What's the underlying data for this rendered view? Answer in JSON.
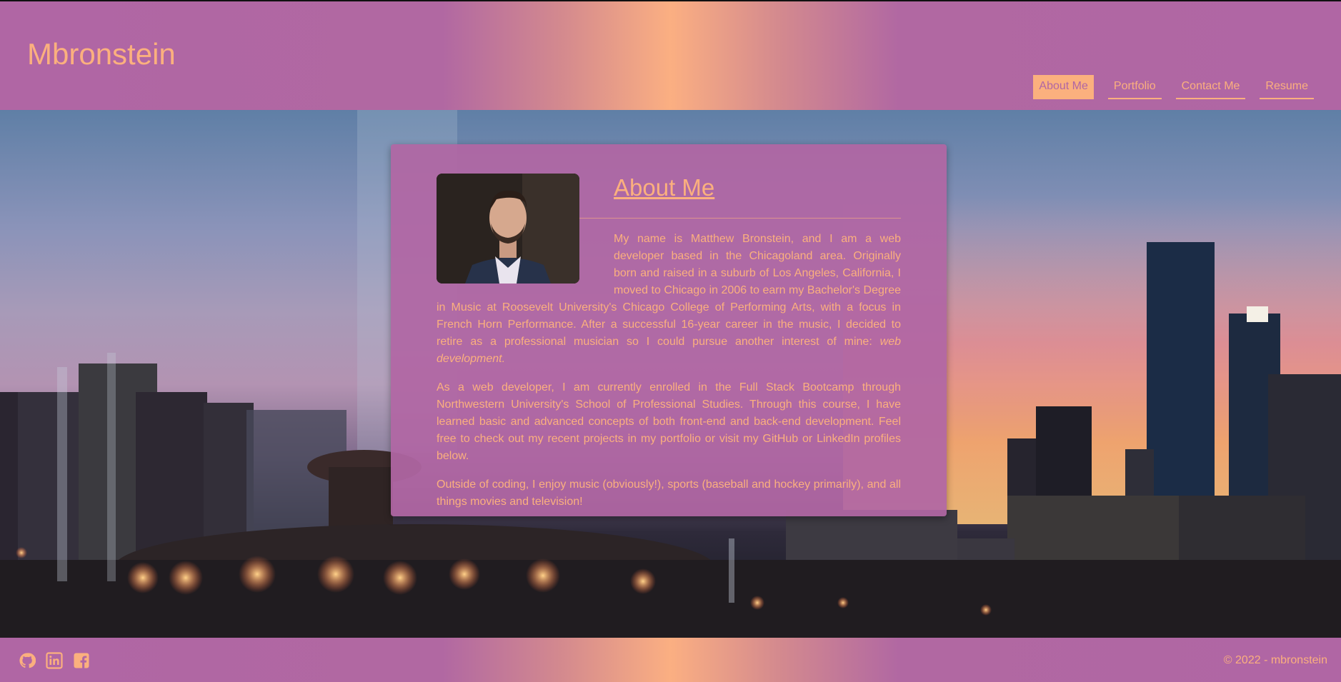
{
  "header": {
    "site_title": "Mbronstein",
    "nav": [
      {
        "label": "About Me",
        "active": true
      },
      {
        "label": "Portfolio",
        "active": false
      },
      {
        "label": "Contact Me",
        "active": false
      },
      {
        "label": "Resume",
        "active": false
      }
    ]
  },
  "about": {
    "title": "About Me",
    "paragraph1_main": "My name is Matthew Bronstein, and I am a web developer based in the Chicagoland area. Originally born and raised in a suburb of Los Angeles, California, I moved to Chicago in 2006 to earn my Bachelor's Degree in Music at Roosevelt University's Chicago College of Performing Arts, with a focus in French Horn Performance. After a successful 16-year career in the music, I decided to retire as a professional musician so I could pursue another interest of mine: ",
    "paragraph1_emphasis": "web development.",
    "paragraph2": "As a web developer, I am currently enrolled in the Full Stack Bootcamp through Northwestern University's School of Professional Studies. Through this course, I have learned basic and advanced concepts of both front-end and back-end development. Feel free to check out my recent projects in my portfolio or visit my GitHub or LinkedIn profiles below.",
    "paragraph3": "Outside of coding, I enjoy music (obviously!), sports (baseball and hockey primarily), and all things movies and television!"
  },
  "footer": {
    "social_icons": [
      "github-icon",
      "linkedin-icon",
      "facebook-icon"
    ],
    "copyright": "© 2022 - mbronstein"
  },
  "colors": {
    "primary": "#b066a4",
    "accent": "#fbb07e"
  }
}
